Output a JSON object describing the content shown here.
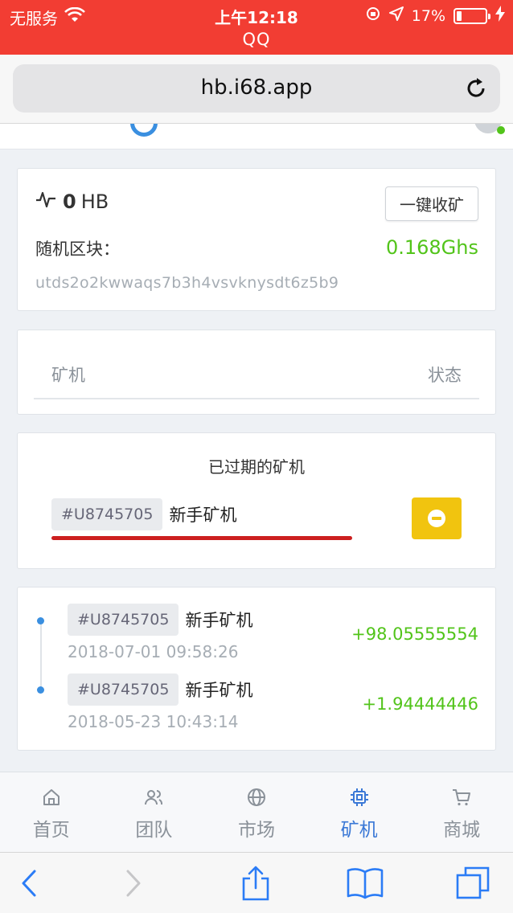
{
  "status_bar": {
    "carrier": "无服务",
    "time": "上午12:18",
    "battery_percent": "17%",
    "battery_level": 0.17
  },
  "app_title": "QQ",
  "browser": {
    "url": "hb.i68.app"
  },
  "summary_card": {
    "balance_value": "0",
    "balance_unit": "HB",
    "collect_button": "一键收矿",
    "random_block_label": "随机区块：",
    "hashrate": "0.168Ghs",
    "block_hash": "utds2o2kwwaqs7b3h4vsvknysdt6z5b9"
  },
  "miner_table": {
    "col_miner": "矿机",
    "col_status": "状态"
  },
  "expired": {
    "title": "已过期的矿机",
    "miner_id": "#U8745705",
    "miner_name": "新手矿机"
  },
  "records": [
    {
      "miner_id": "#U8745705",
      "miner_name": "新手矿机",
      "time": "2018-07-01 09:58:26",
      "amount": "+98.05555554"
    },
    {
      "miner_id": "#U8745705",
      "miner_name": "新手矿机",
      "time": "2018-05-23 10:43:14",
      "amount": "+1.94444446"
    }
  ],
  "tabs": [
    {
      "label": "首页",
      "icon": "home-icon",
      "active": false
    },
    {
      "label": "团队",
      "icon": "users-icon",
      "active": false
    },
    {
      "label": "市场",
      "icon": "globe-icon",
      "active": false
    },
    {
      "label": "矿机",
      "icon": "chip-icon",
      "active": true
    },
    {
      "label": "商城",
      "icon": "cart-icon",
      "active": false
    }
  ],
  "colors": {
    "app_bar_red": "#f23d33",
    "accent_blue": "#3a78d6",
    "positive_green": "#52c41a",
    "warning_yellow": "#f1c40f",
    "underline_red": "#cc1f1f"
  }
}
